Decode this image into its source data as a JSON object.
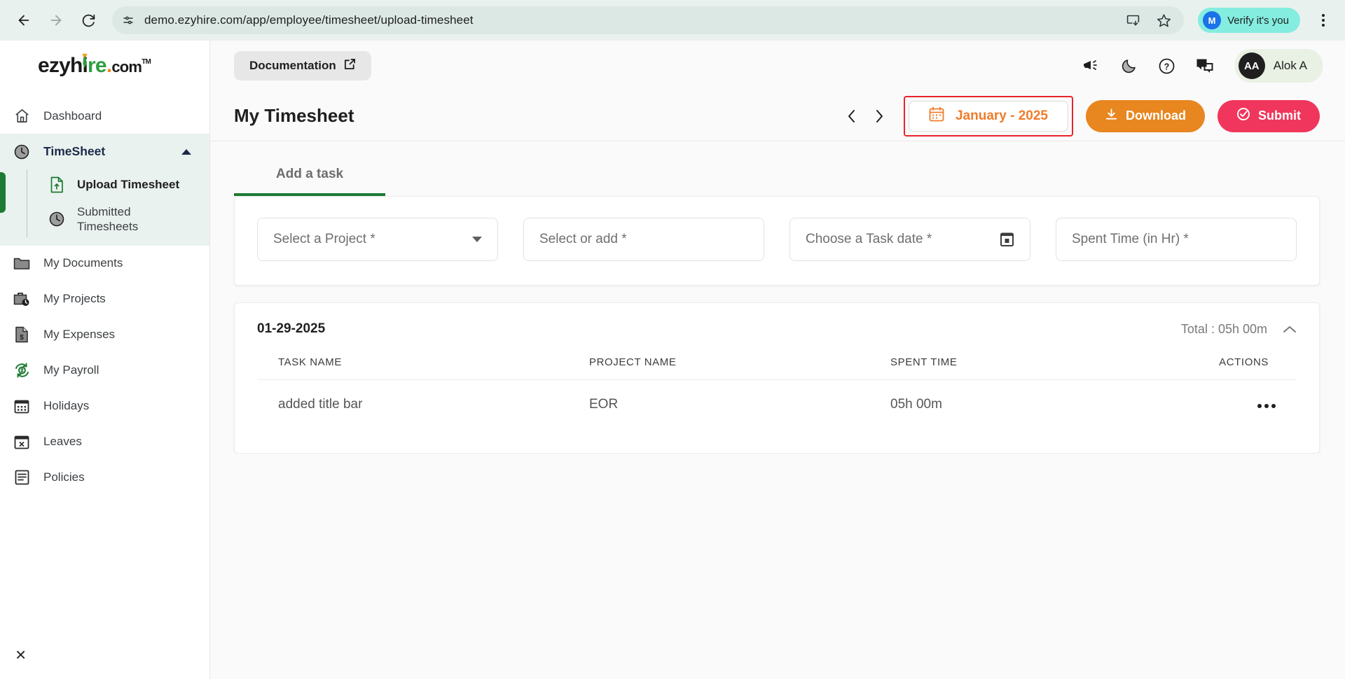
{
  "browser": {
    "url": "demo.ezyhire.com/app/employee/timesheet/upload-timesheet",
    "back_icon": "back-arrow-icon",
    "forward_icon": "forward-arrow-icon",
    "reload_icon": "reload-icon",
    "site_info_icon": "site-settings-icon",
    "install_icon": "install-app-icon",
    "bookmark_icon": "star-icon",
    "verify_label": "Verify it's you",
    "verify_avatar": "M",
    "menu_icon": "kebab-menu-icon"
  },
  "sidebar": {
    "logo": {
      "part1": "ezyh",
      "part2": "i",
      "part3": "r",
      "part4": "e",
      "dot": ".",
      "com": "com",
      "tm": "TM"
    },
    "items": [
      {
        "label": "Dashboard",
        "icon": "home-icon"
      },
      {
        "label": "TimeSheet",
        "icon": "clock-icon"
      },
      {
        "label": "My Documents",
        "icon": "folder-icon"
      },
      {
        "label": "My Projects",
        "icon": "briefcase-clock-icon"
      },
      {
        "label": "My Expenses",
        "icon": "receipt-dollar-icon"
      },
      {
        "label": "My Payroll",
        "icon": "payroll-refresh-icon"
      },
      {
        "label": "Holidays",
        "icon": "calendar-icon"
      },
      {
        "label": "Leaves",
        "icon": "calendar-x-icon"
      },
      {
        "label": "Policies",
        "icon": "document-lines-icon"
      }
    ],
    "timesheet_children": [
      {
        "label": "Upload Timesheet",
        "icon": "file-upload-icon",
        "active": true
      },
      {
        "label": "Submitted Timesheets",
        "icon": "clock-icon",
        "active": false
      }
    ],
    "close_label": "×",
    "accent_green": "#1d7a32",
    "active_bg": "#eaf2ef"
  },
  "topbar": {
    "documentation_label": "Documentation",
    "external_link_icon": "external-link-icon",
    "icons": [
      {
        "name": "announcement-megaphone-icon"
      },
      {
        "name": "dark-mode-moon-icon"
      },
      {
        "name": "help-question-icon"
      },
      {
        "name": "chat-icon"
      }
    ],
    "user": {
      "initials": "AA",
      "name": "Alok A"
    }
  },
  "page_header": {
    "title": "My Timesheet",
    "prev_icon": "chevron-left-icon",
    "next_icon": "chevron-right-icon",
    "month_label": "January - 2025",
    "month_icon": "calendar-icon",
    "month_color": "#ef7c2a",
    "highlight_color": "#e8242a",
    "download_label": "Download",
    "download_icon": "download-icon",
    "download_color": "#e8861f",
    "submit_label": "Submit",
    "submit_icon": "check-circle-icon",
    "submit_color": "#f0365c"
  },
  "main": {
    "tab_label": "Add a task",
    "form": {
      "project": {
        "placeholder": "Select a Project *",
        "value": "",
        "trailing_icon": "chevron-down-icon"
      },
      "task": {
        "placeholder": "Select or add *",
        "value": ""
      },
      "date": {
        "placeholder": "Choose a Task date *",
        "value": "",
        "trailing_icon": "calendar-icon"
      },
      "spent": {
        "placeholder": "Spent Time (in Hr) *",
        "value": ""
      }
    },
    "entry_group": {
      "date": "01-29-2025",
      "total": "Total : 05h 00m",
      "collapse_icon": "chevron-up-icon",
      "columns": [
        "TASK NAME",
        "PROJECT NAME",
        "SPENT TIME",
        "ACTIONS"
      ],
      "rows": [
        {
          "task_name": "added title bar",
          "project_name": "EOR",
          "spent_time": "05h 00m",
          "actions_icon": "more-options-icon"
        }
      ]
    }
  }
}
